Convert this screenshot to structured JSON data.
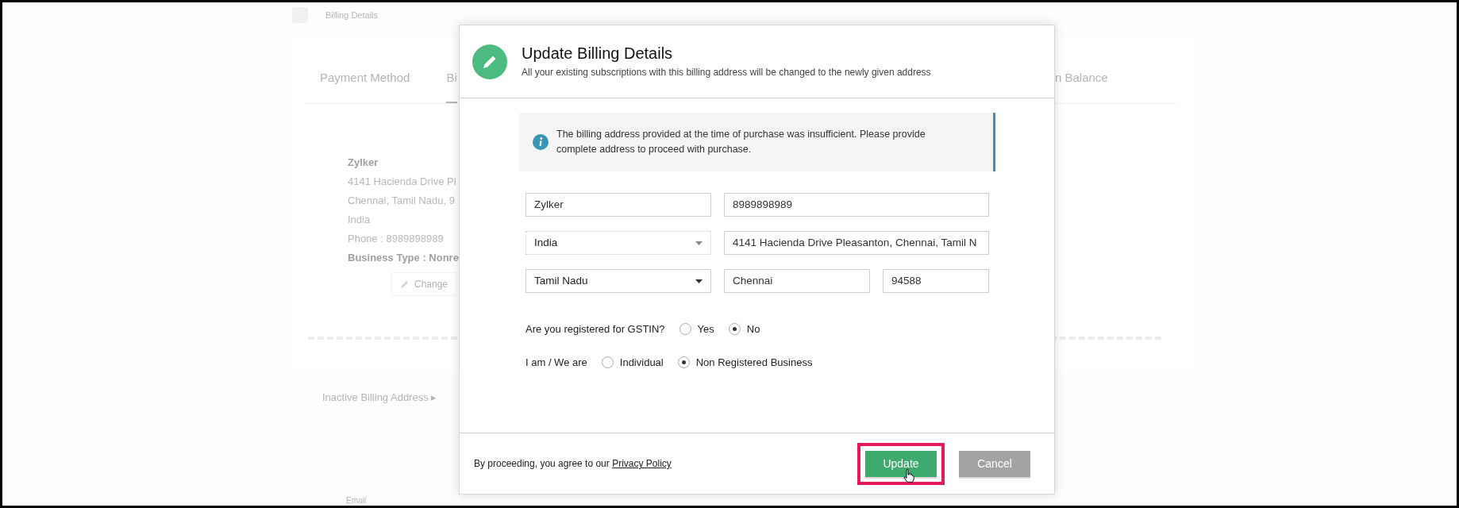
{
  "background": {
    "breadcrumb": "Billing Details",
    "tabs": [
      {
        "label": "Payment Method",
        "selected": false
      },
      {
        "label": "Bi",
        "selected": true
      }
    ],
    "right_tab": "n Balance",
    "address_lines": [
      {
        "text": "Zylker",
        "bold": true
      },
      {
        "text": "4141 Hacienda Drive Pl",
        "bold": false
      },
      {
        "text": "Chennai, Tamil Nadu, 9",
        "bold": false
      },
      {
        "text": "India",
        "bold": false
      },
      {
        "text": "Phone : 8989898989",
        "bold": false
      },
      {
        "text": "Business Type : Nonre",
        "bold": true
      }
    ],
    "change_button": "Change",
    "inactive_link": "Inactive Billing Address ▸",
    "bottom_label": "Email"
  },
  "dialog": {
    "title": "Update Billing Details",
    "subtitle": "All your existing subscriptions with this billing address will be changed to the newly given address",
    "notice": "The billing address provided at the time of purchase was insufficient. Please provide complete address to proceed with purchase.",
    "field_rows": [
      [
        {
          "kind": "text",
          "value": "Zylker",
          "disabled": false
        },
        {
          "kind": "text",
          "value": "8989898989",
          "disabled": false
        }
      ],
      [
        {
          "kind": "select",
          "value": "India",
          "disabled": true
        },
        {
          "kind": "text",
          "value": "4141 Hacienda Drive Pleasanton, Chennai, Tamil N",
          "disabled": false
        }
      ],
      [
        {
          "kind": "select",
          "value": "Tamil Nadu",
          "disabled": false
        },
        {
          "kind": "text",
          "value": "Chennai",
          "disabled": false
        },
        {
          "kind": "text",
          "value": "94588",
          "disabled": false
        }
      ]
    ],
    "questions": [
      {
        "label": "Are you registered for GSTIN?",
        "options": [
          {
            "label": "Yes",
            "selected": false
          },
          {
            "label": "No",
            "selected": true
          }
        ]
      },
      {
        "label": "I am / We are",
        "options": [
          {
            "label": "Individual",
            "selected": false
          },
          {
            "label": "Non Registered Business",
            "selected": true
          }
        ]
      }
    ],
    "footer_text": "By proceeding, you agree to our",
    "footer_link": "Privacy Policy",
    "buttons": [
      {
        "label": "Update",
        "kind": "primary",
        "highlighted": true
      },
      {
        "label": "Cancel",
        "kind": "secondary",
        "highlighted": false
      }
    ]
  }
}
